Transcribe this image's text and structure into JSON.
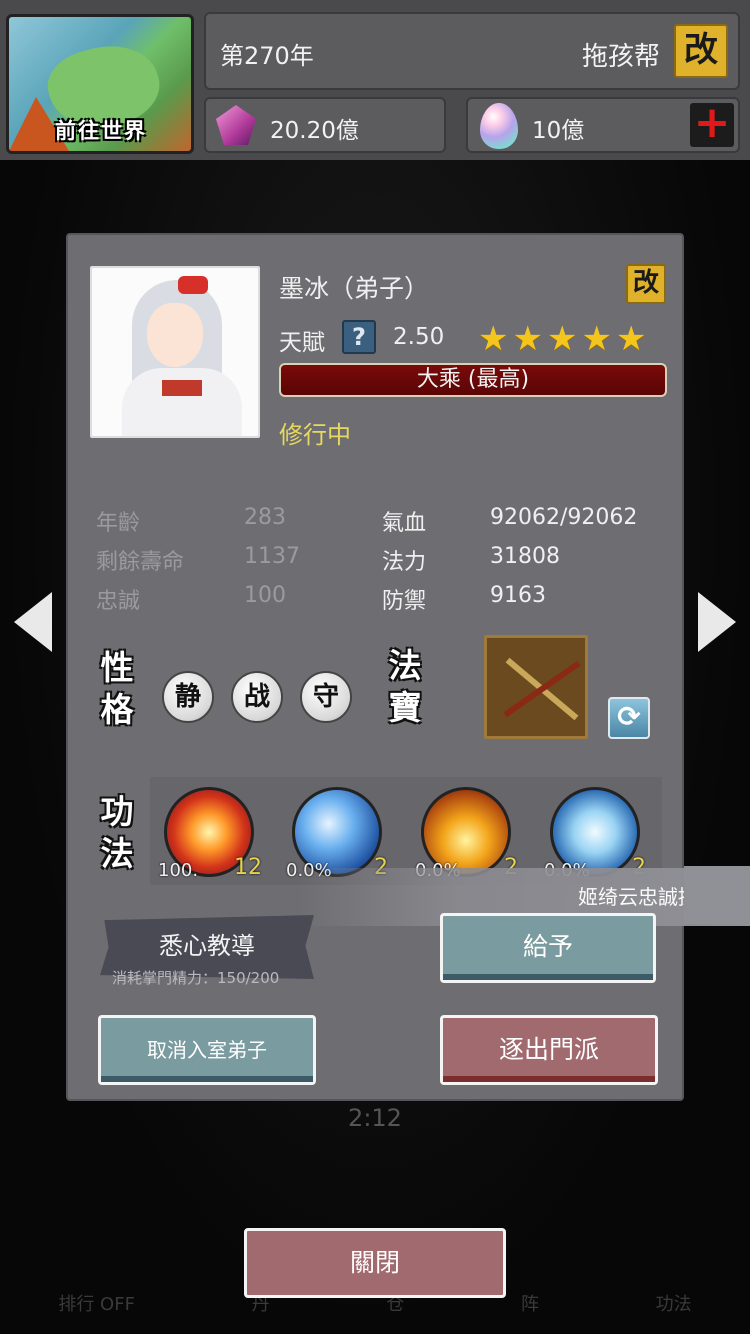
{
  "world": {
    "button_label": "前往世界"
  },
  "header": {
    "year": "第270年",
    "sect_name": "拖孩帮",
    "edit_glyph": "改"
  },
  "resources": {
    "crystal": "20.20億",
    "egg": "10億",
    "add_glyph": "+"
  },
  "character": {
    "name": "墨冰（弟子）",
    "edit_glyph": "改",
    "talent_label": "天賦",
    "talent_help_glyph": "?",
    "talent_value": "2.50",
    "stars": 5,
    "realm": "大乘 (最高)",
    "status": "修行中"
  },
  "stats": [
    {
      "label": "年齡",
      "value": "283",
      "label2": "氣血",
      "value2": "92062/92062"
    },
    {
      "label": "剩餘壽命",
      "value": "1137",
      "label2": "法力",
      "value2": "31808"
    },
    {
      "label": "忠誠",
      "value": "100",
      "label2": "防禦",
      "value2": "9163"
    }
  ],
  "personality": {
    "title": "性格",
    "traits": [
      "静",
      "战",
      "守"
    ]
  },
  "treasure": {
    "title": "法寶",
    "refresh_glyph": "⟳"
  },
  "skills": {
    "title": "功法",
    "items": [
      {
        "progress": "100.",
        "level": "12"
      },
      {
        "progress": "0.0%",
        "level": "2"
      },
      {
        "progress": "0.0%",
        "level": "2"
      },
      {
        "progress": "0.0%",
        "level": "2"
      }
    ]
  },
  "toast": "姬绮云忠誠提高了",
  "actions": {
    "teach_label": "悉心教導",
    "teach_cost": "消耗掌門精力：150/200",
    "give_label": "給予",
    "cancel_label": "取消入室弟子",
    "expel_label": "逐出門派"
  },
  "timer": "2:12",
  "close_label": "關閉",
  "background_nav": [
    "排行 OFF",
    "丹",
    "仓",
    "阵",
    "功法"
  ]
}
